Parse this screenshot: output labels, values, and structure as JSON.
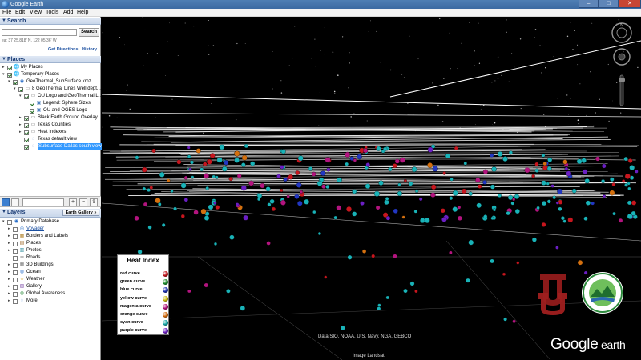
{
  "window": {
    "title": "Google Earth",
    "min_label": "–",
    "max_label": "□",
    "close_label": "✕"
  },
  "menu": [
    "File",
    "Edit",
    "View",
    "Tools",
    "Add",
    "Help"
  ],
  "search": {
    "header": "Search",
    "input_value": "",
    "button_label": "Search",
    "coords": "ea: 37 25.818' N, 122 05.36' W",
    "get_directions": "Get Directions",
    "history": "History"
  },
  "places": {
    "header": "Places",
    "items": [
      {
        "label": "My Places",
        "depth": 0,
        "expander": "▸",
        "checked": true,
        "icon": "folder-globe-icon",
        "selected": false
      },
      {
        "label": "Temporary Places",
        "depth": 0,
        "expander": "▾",
        "checked": true,
        "icon": "folder-globe-icon",
        "selected": false
      },
      {
        "label": "GeoThermal_SubSurface.kmz",
        "depth": 1,
        "expander": "▾",
        "checked": true,
        "icon": "kmz-icon",
        "selected": false
      },
      {
        "label": "8 GeoThermal Lines Well dept...",
        "depth": 2,
        "expander": "▾",
        "checked": true,
        "icon": "folder-icon",
        "selected": false
      },
      {
        "label": "OU Logo and GeoThermal L...",
        "depth": 3,
        "expander": "▾",
        "checked": true,
        "icon": "folder-icon",
        "selected": false
      },
      {
        "label": "Legend: Sphere Sizes",
        "depth": 4,
        "expander": "",
        "checked": true,
        "icon": "overlay-icon",
        "selected": false
      },
      {
        "label": "OU and OGES Logo",
        "depth": 4,
        "expander": "",
        "checked": true,
        "icon": "overlay-icon",
        "selected": false
      },
      {
        "label": "Black Earth Ground Overlay",
        "depth": 3,
        "expander": "▸",
        "checked": true,
        "icon": "folder-icon",
        "selected": false
      },
      {
        "label": "Texas Counties",
        "depth": 3,
        "expander": "▸",
        "checked": true,
        "icon": "folder-icon",
        "selected": false
      },
      {
        "label": "Heat Indexes",
        "depth": 3,
        "expander": "▸",
        "checked": true,
        "icon": "folder-icon",
        "selected": false
      },
      {
        "label": "Texas default view",
        "depth": 3,
        "expander": "",
        "checked": true,
        "icon": "view-icon",
        "selected": false
      },
      {
        "label": "Subsurface Dallas south view",
        "depth": 3,
        "expander": "",
        "checked": true,
        "icon": "view-icon",
        "selected": true
      }
    ]
  },
  "toolstrip": {
    "plus": "+",
    "minus": "−",
    "share": "⇪"
  },
  "layers": {
    "header": "Layers",
    "earth_gallery": "Earth Gallery »",
    "items": [
      {
        "label": "Primary Database",
        "depth": 0,
        "expander": "▾",
        "icon": "database-icon",
        "link": false
      },
      {
        "label": "Voyager",
        "depth": 1,
        "expander": "▸",
        "icon": "voyager-icon",
        "link": true
      },
      {
        "label": "Borders and Labels",
        "depth": 1,
        "expander": "▸",
        "icon": "borders-icon",
        "link": false
      },
      {
        "label": "Places",
        "depth": 1,
        "expander": "▸",
        "icon": "places-icon",
        "link": false
      },
      {
        "label": "Photos",
        "depth": 1,
        "expander": "▸",
        "icon": "photos-icon",
        "link": false
      },
      {
        "label": "Roads",
        "depth": 1,
        "expander": "",
        "icon": "roads-icon",
        "link": false
      },
      {
        "label": "3D Buildings",
        "depth": 1,
        "expander": "▸",
        "icon": "buildings-icon",
        "link": false
      },
      {
        "label": "Ocean",
        "depth": 1,
        "expander": "▸",
        "icon": "ocean-icon",
        "link": false
      },
      {
        "label": "Weather",
        "depth": 1,
        "expander": "▸",
        "icon": "weather-icon",
        "link": false
      },
      {
        "label": "Gallery",
        "depth": 1,
        "expander": "▸",
        "icon": "gallery-icon",
        "link": false
      },
      {
        "label": "Global Awareness",
        "depth": 1,
        "expander": "▸",
        "icon": "awareness-icon",
        "link": false
      },
      {
        "label": "More",
        "depth": 1,
        "expander": "▸",
        "icon": "more-icon",
        "link": false
      }
    ]
  },
  "legend": {
    "title": "Heat Index",
    "entries": [
      {
        "label": "red curve",
        "color": "#c0141b"
      },
      {
        "label": "green curve",
        "color": "#1c8a2a"
      },
      {
        "label": "blue curve",
        "color": "#1b2fb0"
      },
      {
        "label": "yellow curve",
        "color": "#c9b80a"
      },
      {
        "label": "magenta curve",
        "color": "#b0107a"
      },
      {
        "label": "orange curve",
        "color": "#d46a0b"
      },
      {
        "label": "cyan curve",
        "color": "#15a6a6"
      },
      {
        "label": "purple curve",
        "color": "#6a1ec0"
      }
    ]
  },
  "attribution": {
    "data": "Data SIO, NOAA, U.S. Navy, NGA, GEBCO",
    "image": "Image Landsat"
  },
  "logo": {
    "google": "Google",
    "earth": " earth"
  },
  "colors": {
    "cyan": "#19b3b8",
    "red": "#c7161e",
    "magenta": "#b3147f",
    "purple": "#6b1fc4",
    "blue": "#2237c2",
    "orange": "#d4700f",
    "ou_crimson": "#8c1a1a"
  }
}
